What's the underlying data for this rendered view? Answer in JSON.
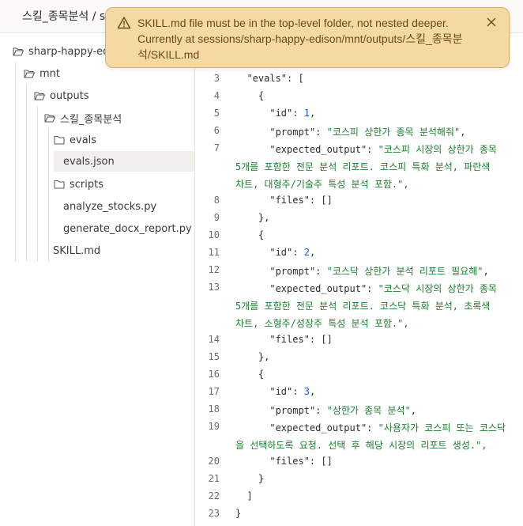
{
  "header": {
    "title": "스킬_종목분석 / s"
  },
  "toast": {
    "message": "SKILL.md file must be in the top-level folder, not nested deeper. Currently at sessions/sharp-happy-edison/mnt/outputs/스킬_종목분석/SKILL.md",
    "icon": "warning-icon",
    "close_icon": "close-icon",
    "color": "#f5d9a5"
  },
  "tree": {
    "root": "sharp-happy-edis",
    "mnt": "mnt",
    "outputs": "outputs",
    "skill_folder": "스킬_종목분석",
    "evals_folder": "evals",
    "evals_json": "evals.json",
    "scripts_folder": "scripts",
    "analyze": "analyze_stocks.py",
    "generate": "generate_docx_report.py",
    "skill_md": "SKILL.md"
  },
  "code": {
    "line_numbers": [
      "3",
      "4",
      "5",
      "6",
      "7",
      "8",
      "9",
      "10",
      "11",
      "12",
      "13",
      "14",
      "15",
      "16",
      "17",
      "18",
      "19",
      "20",
      "21",
      "22",
      "23"
    ],
    "l3": "  \"evals\": [",
    "l4": "    {",
    "l5_key": "      \"id\": ",
    "l5_val": "1",
    "l6_key": "      \"prompt\": ",
    "l6_val": "\"코스피 상한가 종목 분석해줘\"",
    "l7_key": "      \"expected_output\": ",
    "l7_val": "\"코스피 시장의 상한가 종목",
    "l7_w1": "5개를 포함한 전문 분석 리포트. 코스피 특화 분석, 파란색",
    "l7_w2": "차트, 대형주/기술주 특성 분석 포함.\",",
    "l8": "      \"files\": []",
    "l9": "    },",
    "l10": "    {",
    "l11_key": "      \"id\": ",
    "l11_val": "2",
    "l12_key": "      \"prompt\": ",
    "l12_val": "\"코스닥 상한가 분석 리포트 필요해\"",
    "l13_key": "      \"expected_output\": ",
    "l13_val": "\"코스닥 시장의 상한가 종목",
    "l13_w1": "5개를 포함한 전문 분석 리포트. 코스닥 특화 분석, 초록색",
    "l13_w2": "차트, 소형주/성장주 특성 분석 포함.\",",
    "l14": "      \"files\": []",
    "l15": "    },",
    "l16": "    {",
    "l17_key": "      \"id\": ",
    "l17_val": "3",
    "l18_key": "      \"prompt\": ",
    "l18_val": "\"상한가 종목 분석\"",
    "l19_key": "      \"expected_output\": ",
    "l19_val": "\"사용자가 코스피 또는 코스닥",
    "l19_w1": "을 선택하도록 요청. 선택 후 해당 시장의 리포트 생성.\",",
    "l20": "      \"files\": []",
    "l21": "    }",
    "l22": "  ]",
    "l23": "}"
  }
}
